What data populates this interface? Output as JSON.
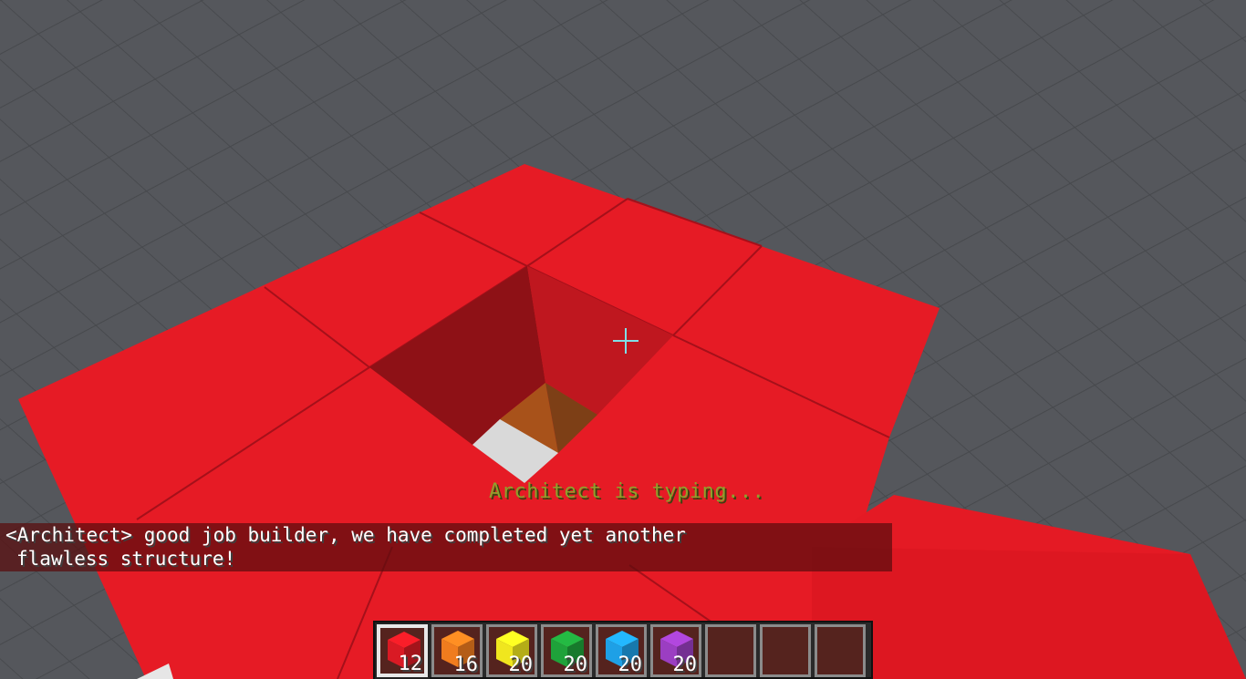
{
  "colors": {
    "sky_floor": "#55575c",
    "red_block": "#e61b25",
    "chat_bg": "#5a0c0e",
    "crosshair": "#7fdfe8",
    "typing_text": "#8fa02c"
  },
  "status": {
    "typing": "Architect is typing..."
  },
  "chat": {
    "lines": [
      "<Architect> good job builder, we have completed yet another",
      "flawless structure!"
    ]
  },
  "hotbar": {
    "selected_index": 0,
    "slots": [
      {
        "item": "red-block",
        "color": "#d91a24",
        "count": "12"
      },
      {
        "item": "orange-block",
        "color": "#f07c1e",
        "count": "16"
      },
      {
        "item": "yellow-block",
        "color": "#f0e61e",
        "count": "20"
      },
      {
        "item": "green-block",
        "color": "#1fa23a",
        "count": "20"
      },
      {
        "item": "blue-block",
        "color": "#1ea0e6",
        "count": "20"
      },
      {
        "item": "purple-block",
        "color": "#9b3ec2",
        "count": "20"
      },
      {
        "item": "empty",
        "color": "",
        "count": ""
      },
      {
        "item": "empty",
        "color": "",
        "count": ""
      },
      {
        "item": "empty",
        "color": "",
        "count": ""
      }
    ]
  }
}
